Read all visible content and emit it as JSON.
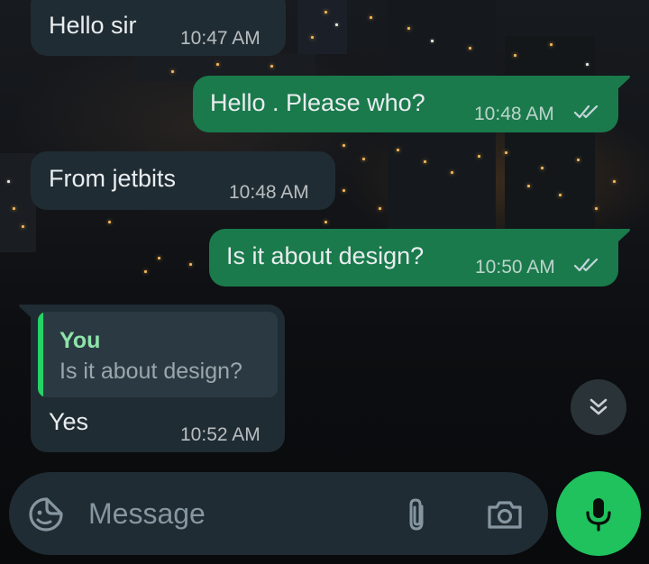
{
  "messages": [
    {
      "direction": "incoming",
      "text": "Hello sir",
      "time": "10:47 AM"
    },
    {
      "direction": "outgoing",
      "text": "Hello . Please who?",
      "time": "10:48 AM",
      "status": "read"
    },
    {
      "direction": "incoming",
      "text": "From jetbits",
      "time": "10:48 AM"
    },
    {
      "direction": "outgoing",
      "text": "Is it about design?",
      "time": "10:50 AM",
      "status": "read"
    },
    {
      "direction": "incoming",
      "text": "Yes",
      "time": "10:52 AM",
      "reply_to": {
        "author": "You",
        "text": "Is it about design?"
      }
    }
  ],
  "scroll_button": {
    "icon": "double-chevron-down-icon"
  },
  "input": {
    "placeholder": "Message",
    "icons": [
      "sticker-icon",
      "paperclip-icon",
      "camera-icon"
    ]
  },
  "mic_button": {
    "icon": "microphone-icon"
  },
  "colors": {
    "incoming_bubble": "#202c33",
    "outgoing_bubble": "#1a7a4c",
    "accent_green": "#1fc25d",
    "quote_bar": "#25d366",
    "quote_author": "#8fe3a9",
    "placeholder_text": "#8696a0"
  }
}
